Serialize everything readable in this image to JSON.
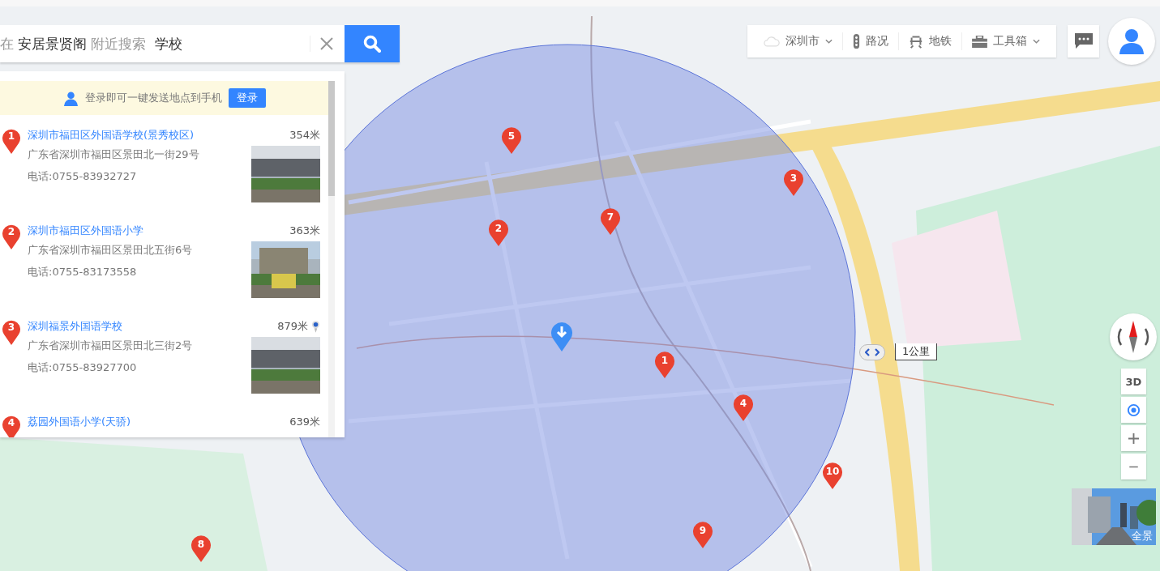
{
  "search": {
    "prefix": "在",
    "place": "安居景贤阁",
    "suffix": "附近搜索",
    "value": "学校"
  },
  "login_banner": {
    "text": "登录即可一键发送地点到手机",
    "button": "登录"
  },
  "results": [
    {
      "index": "1",
      "name": "深圳市福田区外国语学校(景秀校区)",
      "distance": "354米",
      "address": "广东省深圳市福田区景田北一街29号",
      "phone": "电话:0755-83932727",
      "located": false
    },
    {
      "index": "2",
      "name": "深圳市福田区外国语小学",
      "distance": "363米",
      "address": "广东省深圳市福田区景田北五街6号",
      "phone": "电话:0755-83173558",
      "located": false
    },
    {
      "index": "3",
      "name": "深圳福景外国语学校",
      "distance": "879米",
      "address": "广东省深圳市福田区景田北三街2号",
      "phone": "电话:0755-83927700",
      "located": true
    },
    {
      "index": "4",
      "name": "荔园外国语小学(天骄)",
      "distance": "639米"
    }
  ],
  "toolbar": [
    {
      "kind": "city",
      "label": "深圳市"
    },
    {
      "kind": "traffic",
      "label": "路况"
    },
    {
      "kind": "subway",
      "label": "地铁"
    },
    {
      "kind": "toolbox",
      "label": "工具箱"
    }
  ],
  "markers": [
    {
      "label": "1"
    },
    {
      "label": "2"
    },
    {
      "label": "3"
    },
    {
      "label": "4"
    },
    {
      "label": "5"
    },
    {
      "label": "7"
    },
    {
      "label": "8"
    },
    {
      "label": "9"
    },
    {
      "label": "10"
    }
  ],
  "scale": {
    "label": "1公里"
  },
  "map_controls": [
    {
      "kind": "threed",
      "label": "3D"
    },
    {
      "kind": "locate"
    },
    {
      "kind": "zoom_in"
    },
    {
      "kind": "zoom_out"
    }
  ],
  "panorama": {
    "label": "全景"
  }
}
